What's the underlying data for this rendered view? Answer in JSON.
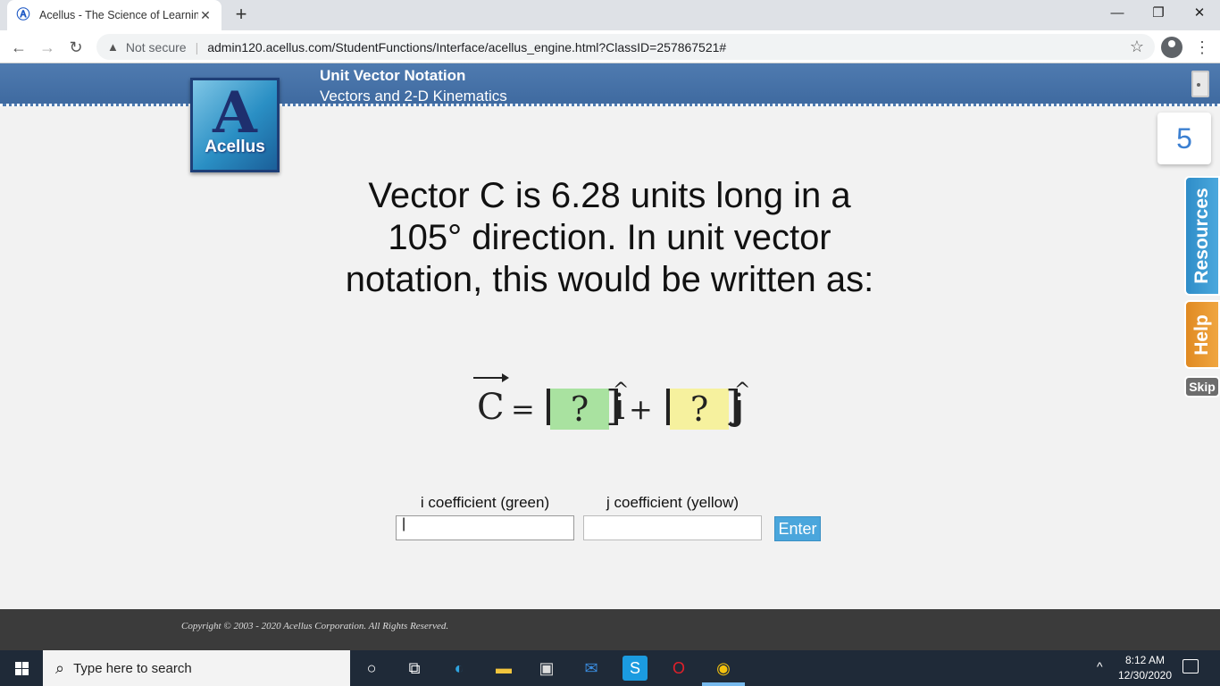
{
  "browser": {
    "tab_title": "Acellus - The Science of Learning",
    "tab_favicon": "acellus-icon",
    "new_tab": "+",
    "security_label": "Not secure",
    "url": "admin120.acellus.com/StudentFunctions/Interface/acellus_engine.html?ClassID=257867521#"
  },
  "lesson": {
    "title": "Unit Vector Notation",
    "subtitle": "Vectors and 2-D Kinematics",
    "logo_text": "Acellus",
    "logo_letter": "A",
    "problem_count": "5",
    "resources_label": "Resources",
    "help_label": "Help",
    "skip_label": "Skip"
  },
  "question": {
    "text": "Vector C is 6.28 units long in a 105° direction. In unit vector notation, this would be written as:",
    "equation": {
      "vector": "C",
      "equals": "=",
      "placeholder_i": "?",
      "placeholder_j": "?",
      "unit_i": "i",
      "unit_j": "j",
      "plus": "+"
    }
  },
  "answer_form": {
    "i_label": "i coefficient (green)",
    "j_label": "j coefficient (yellow)",
    "i_value": "",
    "j_value": "",
    "enter_label": "Enter"
  },
  "footer": {
    "copyright": "Copyright © 2003 - 2020 Acellus Corporation.  All Rights Reserved."
  },
  "taskbar": {
    "search_placeholder": "Type here to search",
    "time": "8:12 AM",
    "date": "12/30/2020"
  },
  "colors": {
    "header_blue": "#4577ac",
    "green_box": "#a9e2a0",
    "yellow_box": "#f6f19e",
    "resources_blue": "#3a98d4",
    "help_orange": "#e8962f"
  }
}
